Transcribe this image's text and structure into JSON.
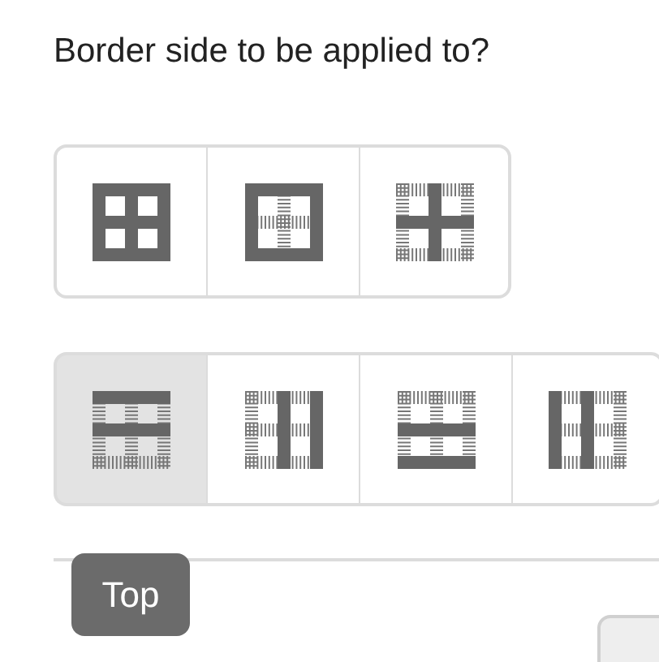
{
  "title": "Border side to be applied to?",
  "groups": [
    {
      "buttons": [
        {
          "kind": "all",
          "selected": false
        },
        {
          "kind": "outer",
          "selected": false
        },
        {
          "kind": "inner",
          "selected": false
        }
      ]
    },
    {
      "buttons": [
        {
          "kind": "top-middle",
          "selected": true
        },
        {
          "kind": "middle-right",
          "selected": false
        },
        {
          "kind": "middle-bottom",
          "selected": false
        },
        {
          "kind": "left-middle",
          "selected": false
        }
      ]
    }
  ],
  "tooltip": "Top"
}
